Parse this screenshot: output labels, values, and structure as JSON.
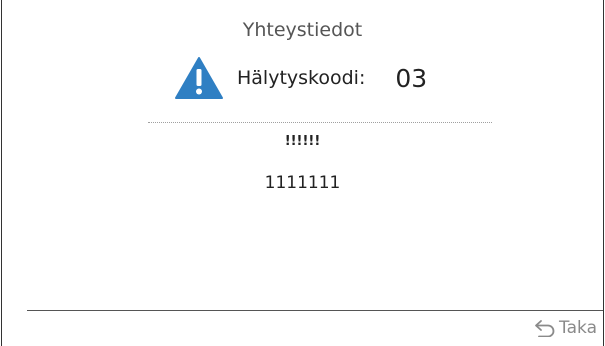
{
  "header": {
    "title": "Yhteystiedot"
  },
  "alarm": {
    "icon": "warning-icon",
    "label": "Hälytyskoodi:",
    "code": "03"
  },
  "contact": {
    "line1": "!!!!!!",
    "line2": "1111111"
  },
  "footer": {
    "back_icon": "back-arrow-icon",
    "back_label": "Taka"
  },
  "colors": {
    "warning_icon": "#2f7fc3",
    "back_button": "#8a8a8a"
  }
}
